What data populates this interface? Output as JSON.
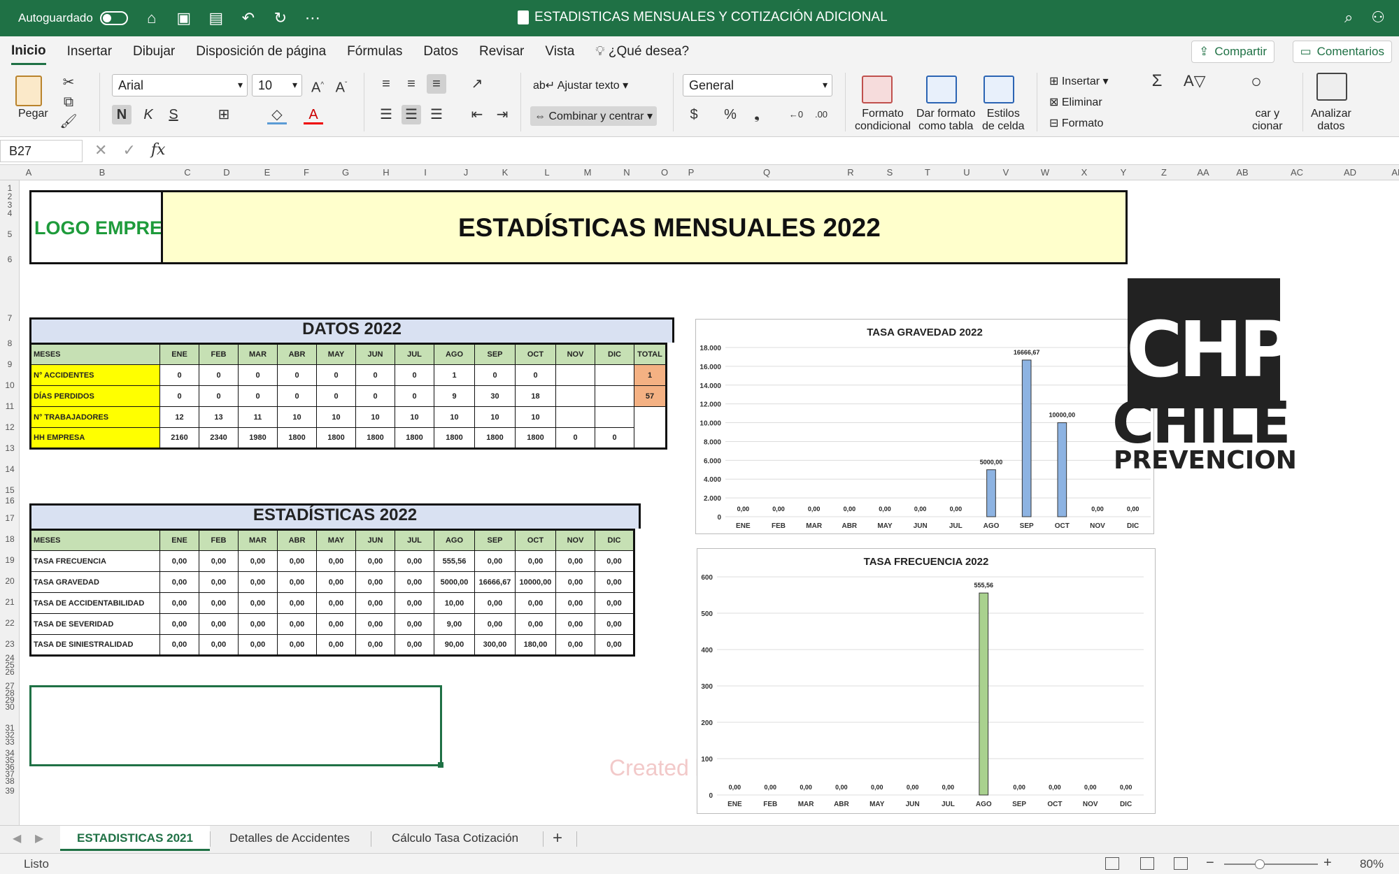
{
  "titlebar": {
    "autosave_label": "Autoguardado",
    "doc_title": "ESTADISTICAS MENSUALES Y COTIZACIÓN ADICIONAL"
  },
  "ribbon_tabs": [
    "Inicio",
    "Insertar",
    "Dibujar",
    "Disposición de página",
    "Fórmulas",
    "Datos",
    "Revisar",
    "Vista",
    "¿Qué desea?"
  ],
  "share_label": "Compartir",
  "comments_label": "Comentarios",
  "ribbon": {
    "paste_label": "Pegar",
    "font_name": "Arial",
    "font_size": "10",
    "bold": "N",
    "italic": "K",
    "underline": "S",
    "wrap_text": "Ajustar texto",
    "merge_center": "Combinar y centrar",
    "number_format": "General",
    "currency": "$",
    "percent": "%",
    "comma": "❟",
    "cond_format": [
      "Formato",
      "condicional"
    ],
    "format_table": [
      "Dar formato",
      "como tabla"
    ],
    "cell_styles": [
      "Estilos",
      "de celda"
    ],
    "insert": "Insertar",
    "delete": "Eliminar",
    "format": "Formato",
    "find_select": [
      "car y",
      "cionar"
    ],
    "analyze": [
      "Analizar",
      "datos"
    ]
  },
  "formula_bar": {
    "name_box": "B27",
    "fx": "fx"
  },
  "columns": [
    "A",
    "B",
    "C",
    "D",
    "E",
    "F",
    "G",
    "H",
    "I",
    "J",
    "K",
    "L",
    "M",
    "N",
    "O",
    "P",
    "Q",
    "R",
    "S",
    "T",
    "U",
    "V",
    "W",
    "X",
    "Y",
    "Z",
    "AA",
    "AB",
    "AC",
    "AD",
    "AE"
  ],
  "rows": [
    "1",
    "2",
    "3",
    "4",
    "5",
    "6",
    "7",
    "8",
    "9",
    "10",
    "11",
    "12",
    "13",
    "14",
    "15",
    "16",
    "17",
    "18",
    "19",
    "20",
    "21",
    "22",
    "23",
    "24",
    "25",
    "26",
    "27",
    "28",
    "29",
    "30",
    "31",
    "32",
    "33",
    "34",
    "35",
    "36",
    "37",
    "38",
    "39"
  ],
  "sheet": {
    "logo_text": "LOGO EMPRES",
    "main_title": "ESTADÍSTICAS MENSUALES  2022",
    "datos_title": "DATOS 2022",
    "datos_headers": [
      "MESES",
      "ENE",
      "FEB",
      "MAR",
      "ABR",
      "MAY",
      "JUN",
      "JUL",
      "AGO",
      "SEP",
      "OCT",
      "NOV",
      "DIC",
      "TOTAL"
    ],
    "datos_rows": [
      [
        "N° ACCIDENTES",
        "0",
        "0",
        "0",
        "0",
        "0",
        "0",
        "0",
        "1",
        "0",
        "0",
        "",
        "",
        "1"
      ],
      [
        "DÍAS PERDIDOS",
        "0",
        "0",
        "0",
        "0",
        "0",
        "0",
        "0",
        "9",
        "30",
        "18",
        "",
        "",
        "57"
      ],
      [
        "N° TRABAJADORES",
        "12",
        "13",
        "11",
        "10",
        "10",
        "10",
        "10",
        "10",
        "10",
        "10",
        "",
        ""
      ],
      [
        "HH EMPRESA",
        "2160",
        "2340",
        "1980",
        "1800",
        "1800",
        "1800",
        "1800",
        "1800",
        "1800",
        "1800",
        "0",
        "0"
      ]
    ],
    "estad_title": "ESTADÍSTICAS 2022",
    "estad_headers": [
      "MESES",
      "ENE",
      "FEB",
      "MAR",
      "ABR",
      "MAY",
      "JUN",
      "JUL",
      "AGO",
      "SEP",
      "OCT",
      "NOV",
      "DIC"
    ],
    "estad_rows": [
      [
        "TASA FRECUENCIA",
        "0,00",
        "0,00",
        "0,00",
        "0,00",
        "0,00",
        "0,00",
        "0,00",
        "555,56",
        "0,00",
        "0,00",
        "0,00",
        "0,00"
      ],
      [
        "TASA GRAVEDAD",
        "0,00",
        "0,00",
        "0,00",
        "0,00",
        "0,00",
        "0,00",
        "0,00",
        "5000,00",
        "16666,67",
        "10000,00",
        "0,00",
        "0,00"
      ],
      [
        "TASA DE ACCIDENTABILIDAD",
        "0,00",
        "0,00",
        "0,00",
        "0,00",
        "0,00",
        "0,00",
        "0,00",
        "10,00",
        "0,00",
        "0,00",
        "0,00",
        "0,00"
      ],
      [
        "TASA DE SEVERIDAD",
        "0,00",
        "0,00",
        "0,00",
        "0,00",
        "0,00",
        "0,00",
        "0,00",
        "9,00",
        "0,00",
        "0,00",
        "0,00",
        "0,00"
      ],
      [
        "TASA DE SINIESTRALIDAD",
        "0,00",
        "0,00",
        "0,00",
        "0,00",
        "0,00",
        "0,00",
        "0,00",
        "90,00",
        "300,00",
        "180,00",
        "0,00",
        "0,00"
      ]
    ],
    "watermark": "Created by Paint S",
    "brand_logo": {
      "line1": "CHP",
      "line2": "CHILE",
      "line3": "PREVENCION"
    }
  },
  "chart_data": [
    {
      "type": "bar",
      "title": "TASA GRAVEDAD 2022",
      "categories": [
        "ENE",
        "FEB",
        "MAR",
        "ABR",
        "MAY",
        "JUN",
        "JUL",
        "AGO",
        "SEP",
        "OCT",
        "NOV",
        "DIC"
      ],
      "values": [
        0,
        0,
        0,
        0,
        0,
        0,
        0,
        5000,
        16666.67,
        10000,
        0,
        0
      ],
      "data_labels": [
        "0,00",
        "0,00",
        "0,00",
        "0,00",
        "0,00",
        "0,00",
        "0,00",
        "5000,00",
        "16666,67",
        "10000,00",
        "0,00",
        "0,00"
      ],
      "yticks": [
        "0",
        "2.000",
        "4.000",
        "6.000",
        "8.000",
        "10.000",
        "12.000",
        "14.000",
        "16.000",
        "18.000"
      ],
      "ylim": [
        0,
        18000
      ],
      "color": "#8db3e2",
      "grid": true
    },
    {
      "type": "bar",
      "title": "TASA FRECUENCIA 2022",
      "categories": [
        "ENE",
        "FEB",
        "MAR",
        "ABR",
        "MAY",
        "JUN",
        "JUL",
        "AGO",
        "SEP",
        "OCT",
        "NOV",
        "DIC"
      ],
      "values": [
        0,
        0,
        0,
        0,
        0,
        0,
        0,
        555.56,
        0,
        0,
        0,
        0
      ],
      "data_labels": [
        "0,00",
        "0,00",
        "0,00",
        "0,00",
        "0,00",
        "0,00",
        "0,00",
        "555,56",
        "0,00",
        "0,00",
        "0,00",
        "0,00"
      ],
      "yticks": [
        "0",
        "100",
        "200",
        "300",
        "400",
        "500",
        "600"
      ],
      "ylim": [
        0,
        600
      ],
      "color": "#a9d18e",
      "grid": true
    }
  ],
  "sheet_tabs": [
    "ESTADISTICAS 2021",
    "Detalles de Accidentes",
    "Cálculo Tasa Cotización"
  ],
  "status": {
    "text": "Listo",
    "zoom": "80%"
  }
}
